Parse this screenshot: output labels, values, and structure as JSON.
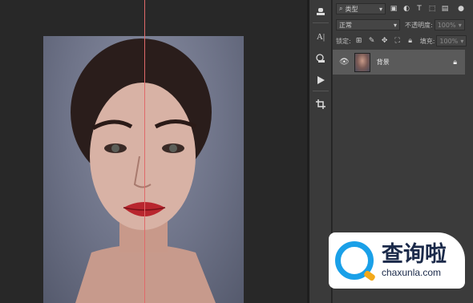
{
  "canvas": {
    "guide_color": "#e06a6a"
  },
  "tools": [
    {
      "icon": "stamp-icon",
      "glyph": "♙"
    },
    {
      "icon": "character-icon",
      "glyph": "A|"
    },
    {
      "icon": "paragraph-icon",
      "glyph": "¶"
    },
    {
      "icon": "play-icon",
      "glyph": "▶"
    },
    {
      "icon": "crop-icon",
      "glyph": "⌗"
    }
  ],
  "layers_panel": {
    "filter_label": "类型",
    "blend_mode": "正常",
    "opacity_label": "不透明度:",
    "opacity_value": "100%",
    "lock_label": "锁定:",
    "fill_label": "填充:",
    "fill_value": "100%",
    "layer_name": "背景"
  },
  "watermark": {
    "cn": "查询啦",
    "en": "chaxunla.com",
    "brand_blue": "#1aa0e8",
    "brand_orange": "#f3a91b"
  }
}
